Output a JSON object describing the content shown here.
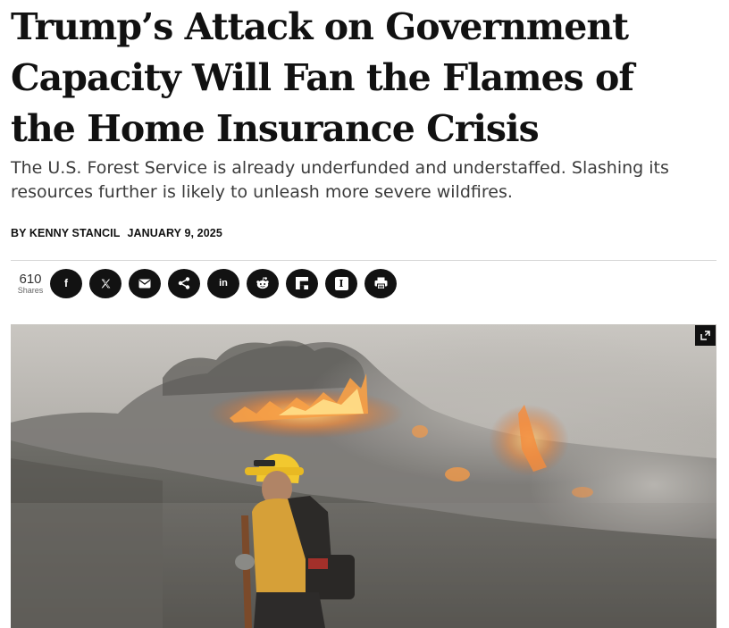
{
  "article": {
    "headline_lines": [
      "Trump’s Attack on Government",
      "Capacity Will Fan the Flames of",
      "the Home Insurance Crisis"
    ],
    "dek_lines": [
      "The U.S. Forest Service is already underfunded and understaffed. Slashing its",
      "resources further is likely to unleash more severe wildfires."
    ],
    "byline": {
      "author": "BY KENNY STANCIL",
      "date": "JANUARY 9, 2025"
    }
  },
  "share_bar": {
    "count": "610",
    "count_label": "Shares",
    "buttons": [
      {
        "id": "facebook",
        "icon": "facebook-icon",
        "glyph": "f"
      },
      {
        "id": "x",
        "icon": "x-icon",
        "glyph": "𝕏"
      },
      {
        "id": "email",
        "icon": "email-icon",
        "glyph": ""
      },
      {
        "id": "share",
        "icon": "share-icon",
        "glyph": ""
      },
      {
        "id": "linkedin",
        "icon": "linkedin-icon",
        "glyph": "in"
      },
      {
        "id": "reddit",
        "icon": "reddit-icon",
        "glyph": ""
      },
      {
        "id": "flipboard",
        "icon": "flipboard-icon",
        "glyph": ""
      },
      {
        "id": "instapaper",
        "icon": "instapaper-icon",
        "glyph": "I"
      },
      {
        "id": "print",
        "icon": "print-icon",
        "glyph": ""
      }
    ],
    "button_color": "#121212"
  },
  "hero_image": {
    "subject": "firefighter-photo",
    "expand_icon": "expand-icon"
  }
}
